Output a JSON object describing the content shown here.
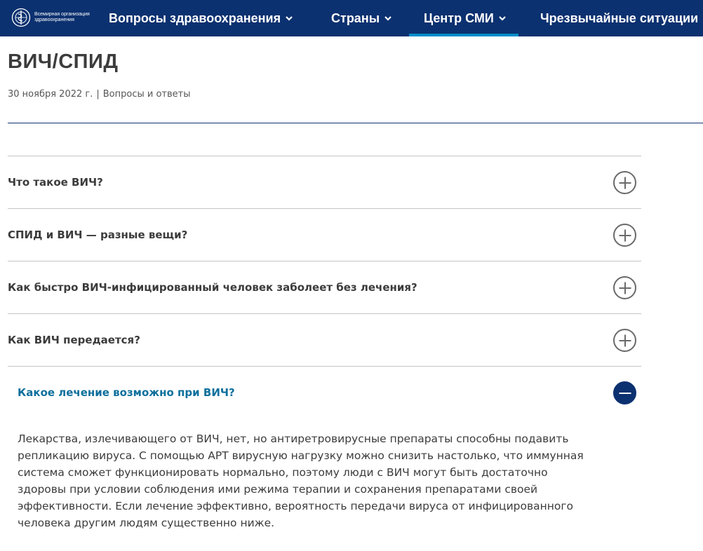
{
  "nav": {
    "logo_text": "Всемирная организация здравоохранения",
    "items": [
      {
        "label": "Вопросы здравоохранения"
      },
      {
        "label": "Страны"
      },
      {
        "label": "Центр СМИ"
      },
      {
        "label": "Чрезвычайные ситуации"
      }
    ],
    "active_index": 2
  },
  "page": {
    "title": "ВИЧ/СПИД",
    "date": "30 ноября 2022 г.",
    "separator": "|",
    "type": "Вопросы и ответы"
  },
  "accordion": {
    "items": [
      {
        "question": "Что такое ВИЧ?",
        "expanded": false
      },
      {
        "question": "СПИД и ВИЧ — разные вещи?",
        "expanded": false
      },
      {
        "question": "Как быстро ВИЧ-инфицированный человек заболеет без лечения?",
        "expanded": false
      },
      {
        "question": "Как ВИЧ передается?",
        "expanded": false
      },
      {
        "question": "Какое лечение возможно при ВИЧ?",
        "expanded": true,
        "answer": "Лекарства, излечивающего от ВИЧ, нет, но антиретровирусные препараты способны подавить репликацию вируса. С помощью АРТ вирусную нагрузку можно снизить настолько, что иммунная система сможет функционировать нормально, поэтому люди с ВИЧ могут быть достаточно здоровы при условии соблюдения ими режима терапии и сохранения препаратами своей эффективности. Если лечение эффективно, вероятность передачи вируса от инфицированного человека другим людям существенно ниже."
      }
    ]
  },
  "colors": {
    "nav_bg": "#0c3170",
    "active_bar": "#008dc9",
    "expanded_question": "#0d6f9c"
  },
  "icons": [
    "who-emblem-icon",
    "chevron-down-icon",
    "plus-circle-icon",
    "minus-circle-icon"
  ]
}
